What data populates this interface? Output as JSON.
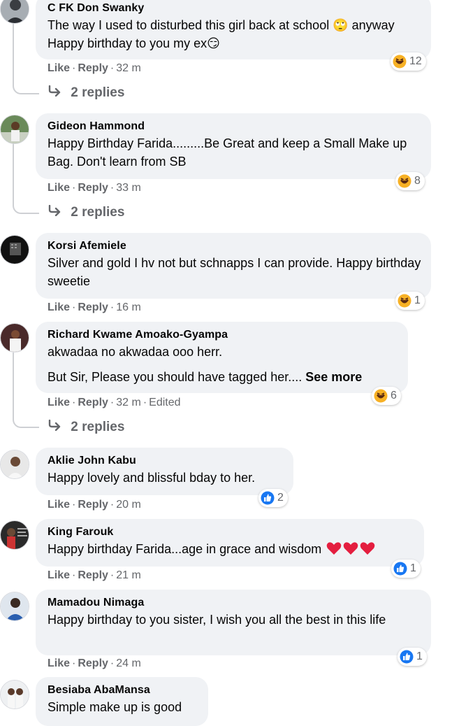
{
  "comments": [
    {
      "author": "C FK Don Swanky",
      "text": "The way I used to disturbed this girl back at school 🙄 anyway Happy birthday to you my ex😏",
      "actions": {
        "like": "Like",
        "reply": "Reply",
        "time": "32 m"
      },
      "reaction": {
        "icon": "laughing-emoji",
        "count": "12"
      },
      "replies": "2 replies"
    },
    {
      "author": "Gideon Hammond",
      "text": "Happy Birthday Farida.........Be Great and keep a Small Make up Bag. Don't learn from SB",
      "actions": {
        "like": "Like",
        "reply": "Reply",
        "time": "33 m"
      },
      "reaction": {
        "icon": "laughing-emoji",
        "count": "8"
      },
      "replies": "2 replies"
    },
    {
      "author": "Korsi Afemiele",
      "text": "Silver and gold I hv not but schnapps I can provide. Happy birthday sweetie",
      "actions": {
        "like": "Like",
        "reply": "Reply",
        "time": "16 m"
      },
      "reaction": {
        "icon": "laughing-emoji",
        "count": "1"
      }
    },
    {
      "author": "Richard Kwame Amoako-Gyampa",
      "text_line1": "akwadaa no akwadaa ooo herr.",
      "text_line2": "But Sir, Please you should have tagged her....",
      "see_more": "See more",
      "actions": {
        "like": "Like",
        "reply": "Reply",
        "time": "32 m",
        "edited": "Edited"
      },
      "reaction": {
        "icon": "laughing-emoji",
        "count": "6"
      },
      "replies": "2 replies"
    },
    {
      "author": "Aklie John Kabu",
      "text": "Happy lovely and blissful bday to her.",
      "actions": {
        "like": "Like",
        "reply": "Reply",
        "time": "20 m"
      },
      "reaction": {
        "icon": "like-icon",
        "count": "2"
      }
    },
    {
      "author": "King Farouk",
      "text": "Happy birthday Farida...age in grace and wisdom",
      "actions": {
        "like": "Like",
        "reply": "Reply",
        "time": "21 m"
      },
      "reaction": {
        "icon": "like-icon",
        "count": "1"
      }
    },
    {
      "author": "Mamadou Nimaga",
      "text": "Happy birthday to you sister, I wish you all the best in this life",
      "actions": {
        "like": "Like",
        "reply": "Reply",
        "time": "24 m"
      },
      "reaction": {
        "icon": "like-icon",
        "count": "1"
      }
    },
    {
      "author": "Besiaba AbaMansa",
      "text": "Simple make up is good"
    }
  ],
  "colors": {
    "bubble": "#f0f2f5",
    "meta": "#65676b",
    "like_blue": "#1877f2",
    "laugh_yellow": "#f7b125",
    "heart_red": "#e41e3f"
  }
}
